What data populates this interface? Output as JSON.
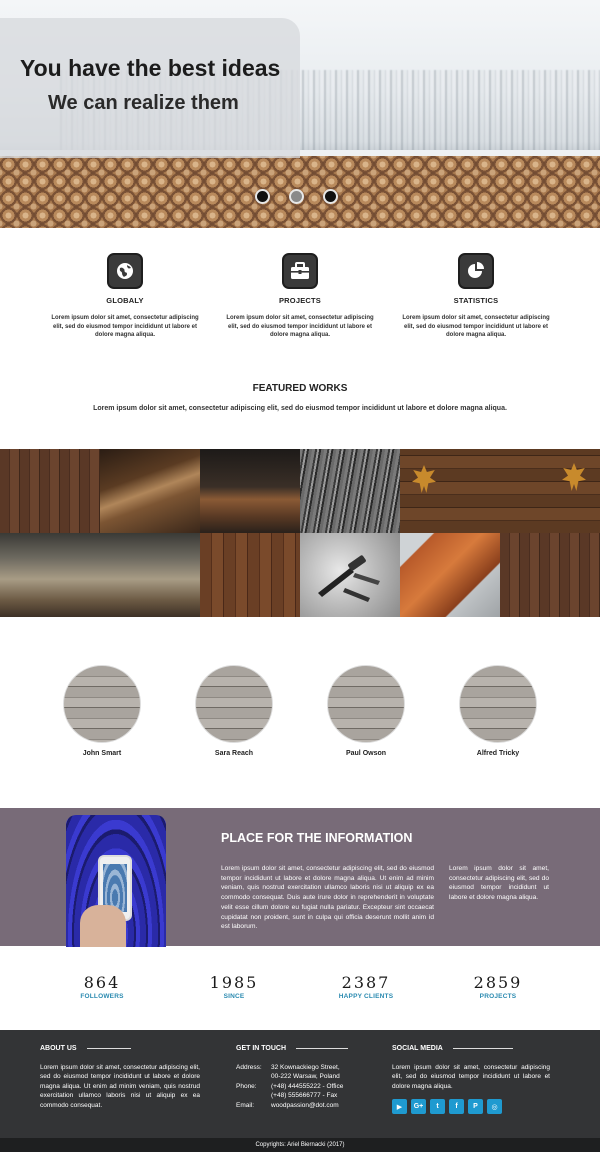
{
  "hero": {
    "title": "You have the best ideas",
    "subtitle": "We can realize them",
    "slider_dots": 3
  },
  "features": [
    {
      "icon": "globe-icon",
      "title": "GLOBALY",
      "text": "Lorem ipsum dolor sit amet, consectetur adipiscing elit, sed do eiusmod tempor incididunt ut labore et dolore magna aliqua."
    },
    {
      "icon": "briefcase-icon",
      "title": "PROJECTS",
      "text": "Lorem ipsum dolor sit amet, consectetur adipiscing elit, sed do eiusmod tempor incididunt ut labore et dolore magna aliqua."
    },
    {
      "icon": "pie-chart-icon",
      "title": "STATISTICS",
      "text": "Lorem ipsum dolor sit amet, consectetur adipiscing elit, sed do eiusmod tempor incididunt ut labore et dolore magna aliqua."
    }
  ],
  "featured": {
    "title": "FEATURED WORKS",
    "text": "Lorem ipsum dolor sit amet, consectetur adipiscing elit, sed do eiusmod tempor incididunt ut labore et dolore magna aliqua."
  },
  "team": [
    {
      "name": "John Smart"
    },
    {
      "name": "Sara Reach"
    },
    {
      "name": "Paul Owson"
    },
    {
      "name": "Alfred Tricky"
    }
  ],
  "info": {
    "title": "PLACE FOR THE INFORMATION",
    "text1": "Lorem ipsum dolor sit amet, consectetur adipiscing elit, sed do eiusmod tempor incididunt ut labore et dolore magna aliqua. Ut enim ad minim veniam, quis nostrud exercitation ullamco laboris nisi ut aliquip ex ea commodo consequat. Duis aute irure dolor in reprehenderit in voluptate velit esse cillum dolore eu fugiat nulla pariatur. Excepteur sint occaecat cupidatat non proident, sunt in culpa qui officia deserunt mollit anim id est laborum.",
    "text2": "Lorem ipsum dolor sit amet, consectetur adipiscing elit, sed do eiusmod tempor incididunt ut labore et dolore magna aliqua."
  },
  "stats": [
    {
      "value": "864",
      "label": "FOLLOWERS"
    },
    {
      "value": "1985",
      "label": "SINCE"
    },
    {
      "value": "2387",
      "label": "HAPPY CLIENTS"
    },
    {
      "value": "2859",
      "label": "PROJECTS"
    }
  ],
  "footer": {
    "about_title": "ABOUT US",
    "about_text": "Lorem ipsum dolor sit amet, consectetur adipiscing elit, sed do eiusmod tempor incididunt ut labore et dolore magna aliqua. Ut enim ad minim veniam, quis nostrud exercitation ullamco laboris nisi ut aliquip ex ea commodo consequat.",
    "contact_title": "GET IN TOUCH",
    "address_label": "Address:",
    "address_line1": "32 Kownackiego Street,",
    "address_line2": "00-222 Warsaw, Poland",
    "phone_label": "Phone:",
    "phone_line1": "(+48) 444555222 - Office",
    "phone_line2": "(+48) 555666777 - Fax",
    "email_label": "Email:",
    "email": "woodpassion@dot.com",
    "social_title": "SOCIAL MEDIA",
    "social_text": "Lorem ipsum dolor sit amet, consectetur adipiscing elit, sed do eiusmod tempor incididunt ut labore et dolore magna aliqua.",
    "social_icons": [
      {
        "name": "youtube-icon",
        "glyph": "▶"
      },
      {
        "name": "google-plus-icon",
        "glyph": "G+"
      },
      {
        "name": "twitter-icon",
        "glyph": "t"
      },
      {
        "name": "facebook-icon",
        "glyph": "f"
      },
      {
        "name": "pinterest-icon",
        "glyph": "P"
      },
      {
        "name": "dribbble-icon",
        "glyph": "◎"
      }
    ],
    "copyright": "Copyrights: Ariel Biernacki (2017)"
  },
  "colors": {
    "info_bg": "#786b78",
    "stat_accent": "#2a8ab0",
    "footer_bg": "#333436",
    "social_button": "#1f9ad0"
  }
}
